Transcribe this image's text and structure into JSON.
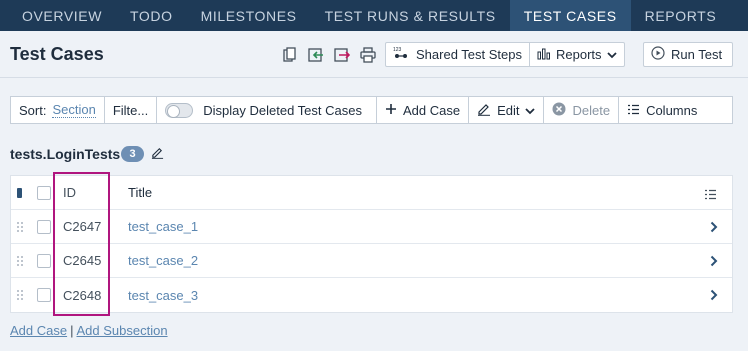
{
  "nav": {
    "tabs": [
      {
        "label": "OVERVIEW"
      },
      {
        "label": "TODO"
      },
      {
        "label": "MILESTONES"
      },
      {
        "label": "TEST RUNS & RESULTS"
      },
      {
        "label": "TEST CASES"
      },
      {
        "label": "REPORTS"
      }
    ],
    "active": "TEST CASES"
  },
  "header": {
    "title": "Test Cases",
    "icons": [
      "copy-icon",
      "import-icon",
      "export-icon",
      "print-icon"
    ],
    "shared_steps_label": "Shared Test Steps",
    "reports_label": "Reports",
    "run_test_label": "Run Test"
  },
  "toolbar": {
    "sort_label": "Sort:",
    "sort_value": "Section",
    "filter_label": "Filte...",
    "display_deleted_label": "Display Deleted Test Cases",
    "add_case_label": "Add Case",
    "edit_label": "Edit",
    "delete_label": "Delete",
    "columns_label": "Columns"
  },
  "section": {
    "title": "tests.LoginTests",
    "count": "3"
  },
  "table": {
    "columns": {
      "id": "ID",
      "title": "Title"
    },
    "rows": [
      {
        "id": "C2647",
        "title": "test_case_1"
      },
      {
        "id": "C2645",
        "title": "test_case_2"
      },
      {
        "id": "C2648",
        "title": "test_case_3"
      }
    ]
  },
  "footer": {
    "add_case_label": "Add Case",
    "separator": "|",
    "add_subsection_label": "Add Subsection"
  },
  "colors": {
    "nav_bg": "#1e3a57",
    "nav_active": "#2d5276",
    "link": "#5b86b0",
    "highlight": "#b0157e",
    "badge": "#6e8fb4"
  }
}
